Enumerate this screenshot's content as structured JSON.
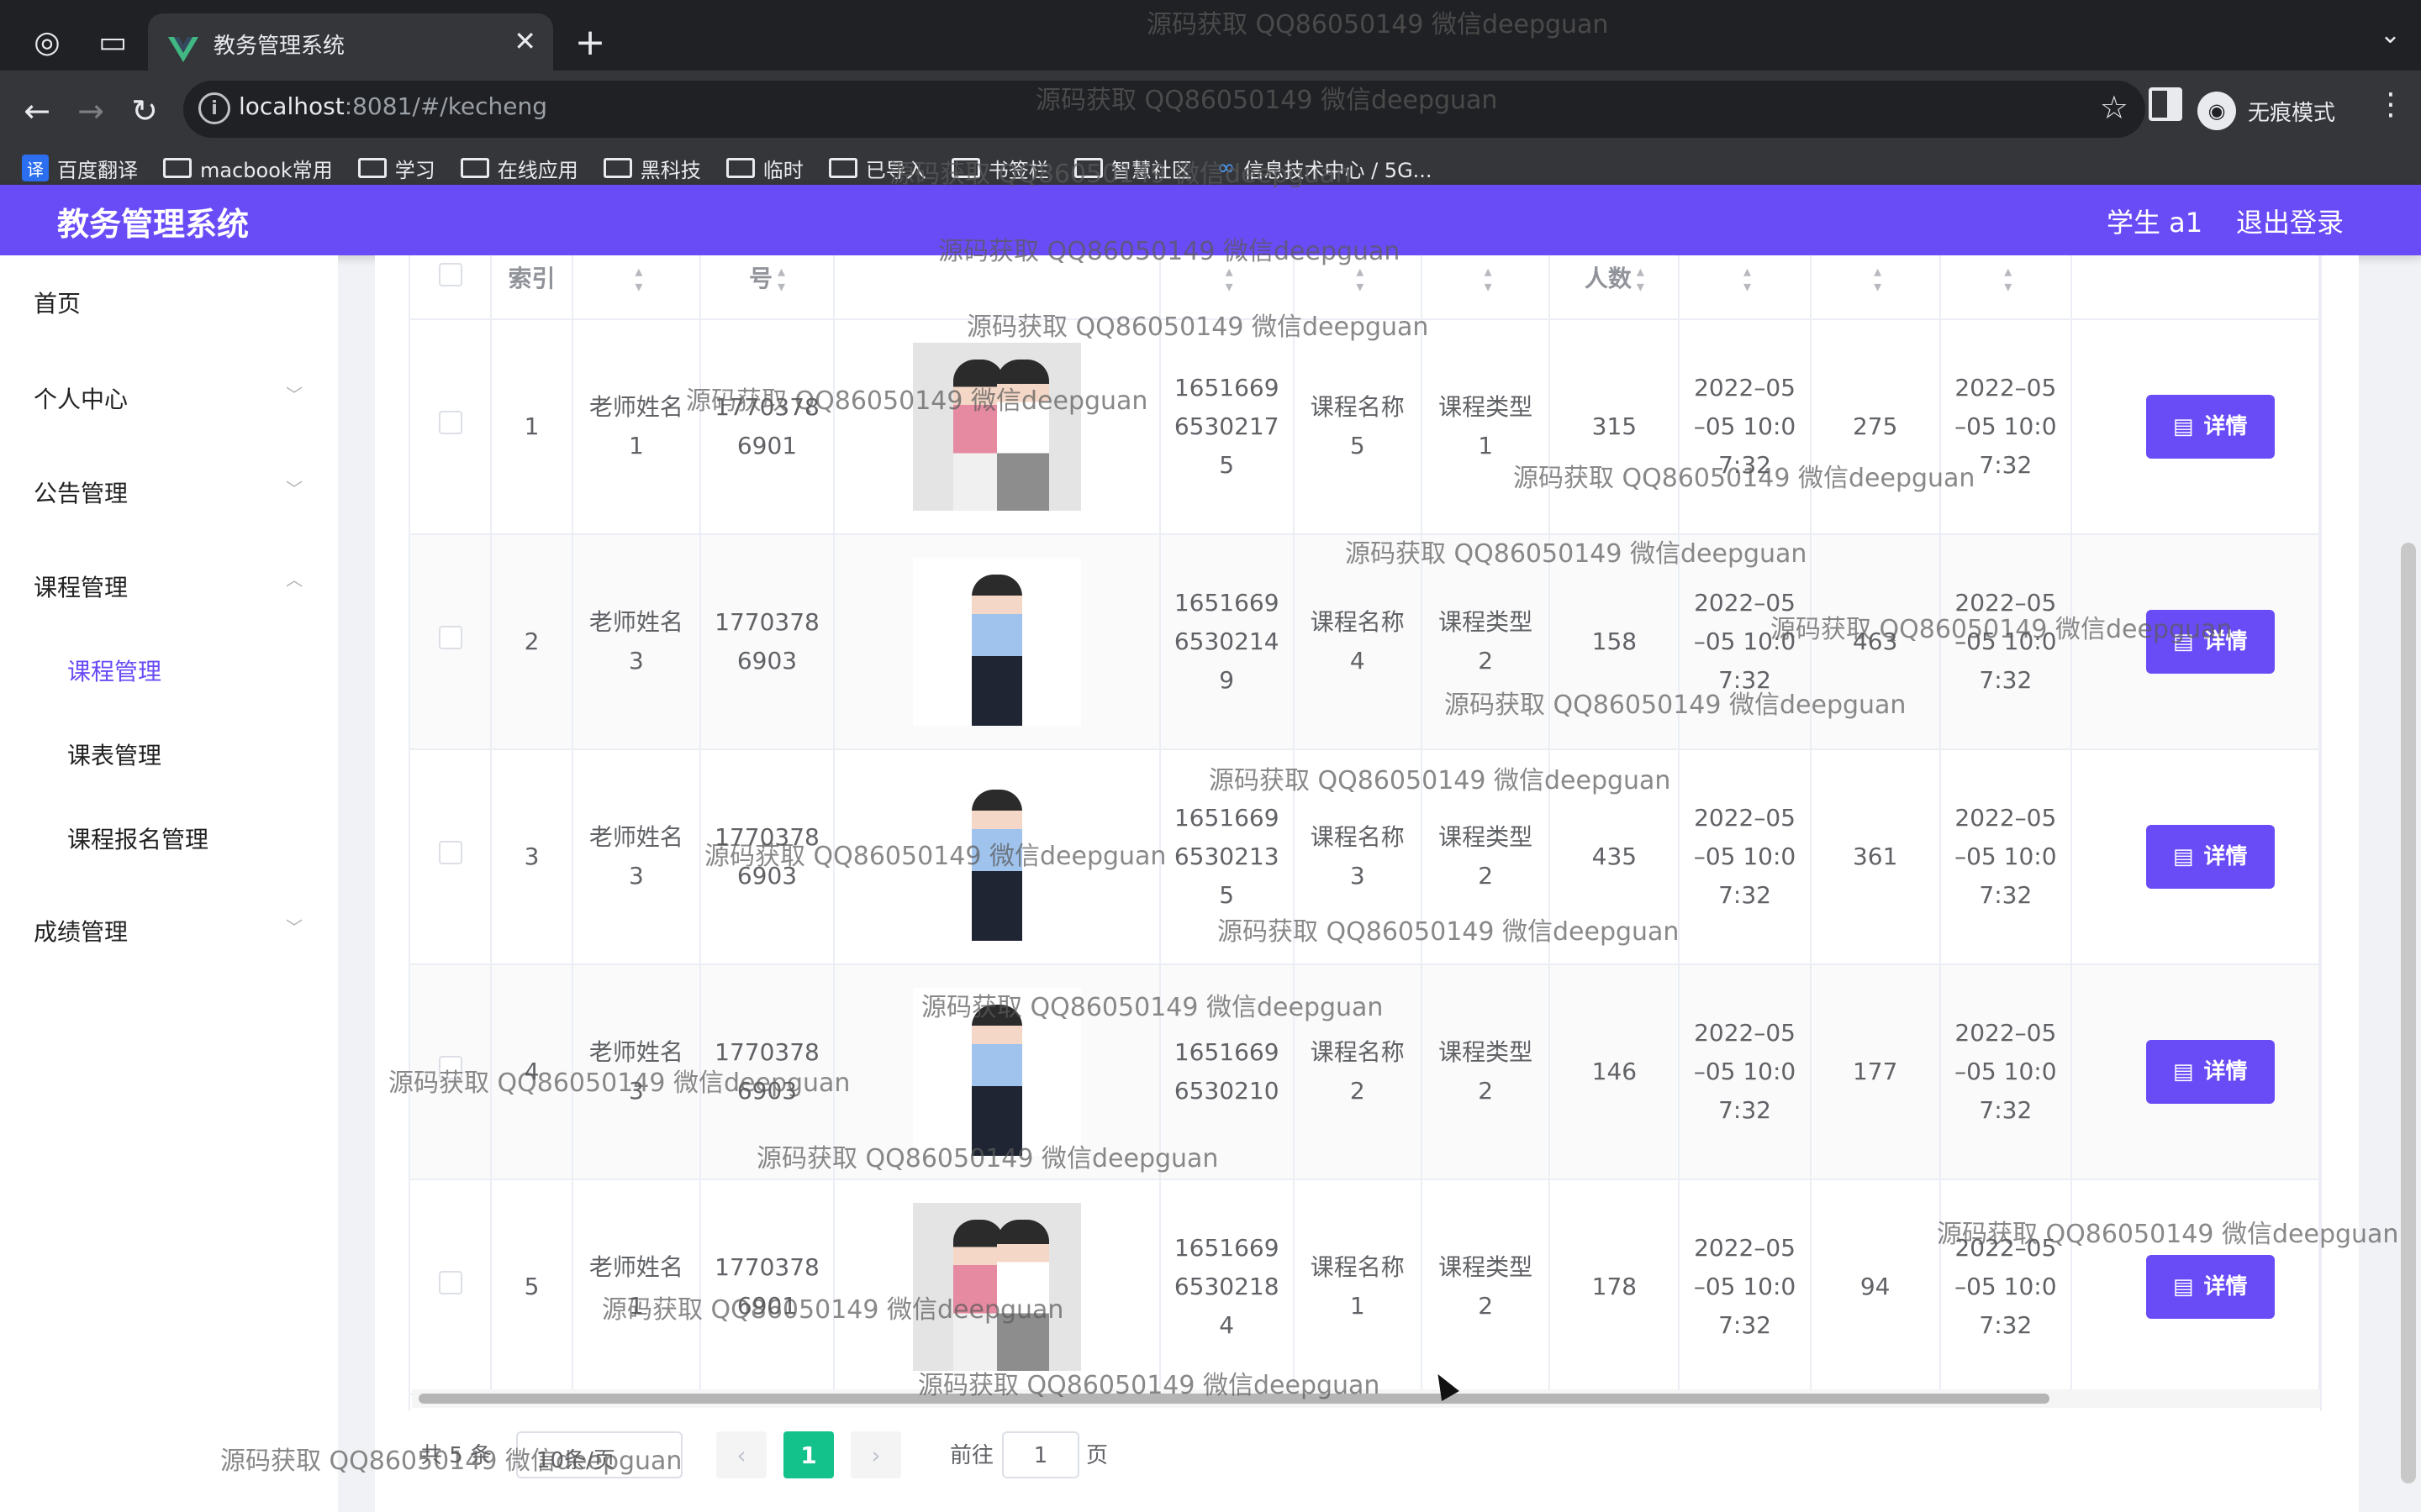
{
  "browser": {
    "tab_title": "教务管理系统",
    "url_host": "localhost",
    "url_rest": ":8081/#/kecheng",
    "incognito_label": "无痕模式",
    "bookmarks": [
      "百度翻译",
      "macbook常用",
      "学习",
      "在线应用",
      "黑科技",
      "临时",
      "已导入",
      "书签栏",
      "智慧社区",
      "信息技术中心 / 5G..."
    ]
  },
  "header": {
    "title": "教务管理系统",
    "user": "学生 a1",
    "logout": "退出登录"
  },
  "sidebar": {
    "items": [
      {
        "label": "首页"
      },
      {
        "label": "个人中心"
      },
      {
        "label": "公告管理"
      },
      {
        "label": "课程管理"
      },
      {
        "label": "课程管理"
      },
      {
        "label": "课表管理"
      },
      {
        "label": "课程报名管理"
      },
      {
        "label": "成绩管理"
      }
    ]
  },
  "table": {
    "headers": [
      "索引",
      "号",
      "人数"
    ],
    "rows": [
      {
        "index": "1",
        "teacher": "老师姓名\n1",
        "phone": "1770378\n6901",
        "code": "1651669\n6530217\n5",
        "course": "课程名称\n5",
        "type": "课程类型\n1",
        "count": "315",
        "time1": "2022–05\n–05 10:0\n7:32",
        "num": "275",
        "time2": "2022–05\n–05 10:0\n7:32",
        "photo": "couple"
      },
      {
        "index": "2",
        "teacher": "老师姓名\n3",
        "phone": "1770378\n6903",
        "code": "1651669\n6530214\n9",
        "course": "课程名称\n4",
        "type": "课程类型\n2",
        "count": "158",
        "time1": "2022–05\n–05 10:0\n7:32",
        "num": "463",
        "time2": "2022–05\n–05 10:0\n7:32",
        "photo": "man"
      },
      {
        "index": "3",
        "teacher": "老师姓名\n3",
        "phone": "1770378\n6903",
        "code": "1651669\n6530213\n5",
        "course": "课程名称\n3",
        "type": "课程类型\n2",
        "count": "435",
        "time1": "2022–05\n–05 10:0\n7:32",
        "num": "361",
        "time2": "2022–05\n–05 10:0\n7:32",
        "photo": "man"
      },
      {
        "index": "4",
        "teacher": "老师姓名\n3",
        "phone": "1770378\n6903",
        "code": "1651669\n6530210",
        "course": "课程名称\n2",
        "type": "课程类型\n2",
        "count": "146",
        "time1": "2022–05\n–05 10:0\n7:32",
        "num": "177",
        "time2": "2022–05\n–05 10:0\n7:32",
        "photo": "man"
      },
      {
        "index": "5",
        "teacher": "老师姓名\n1",
        "phone": "1770378\n6901",
        "code": "1651669\n6530218\n4",
        "course": "课程名称\n1",
        "type": "课程类型\n2",
        "count": "178",
        "time1": "2022–05\n–05 10:0\n7:32",
        "num": "94",
        "time2": "2022–05\n–05 10:0\n7:32",
        "photo": "couple"
      }
    ],
    "detail_label": "详情"
  },
  "pagination": {
    "total": "共 5 条",
    "page_size": "10条/页",
    "prev": "‹",
    "current": "1",
    "next": "›",
    "goto_label": "前往",
    "goto_value": "1",
    "goto_suffix": "页"
  },
  "watermark": "源码获取 QQ86050149 微信deepguan"
}
